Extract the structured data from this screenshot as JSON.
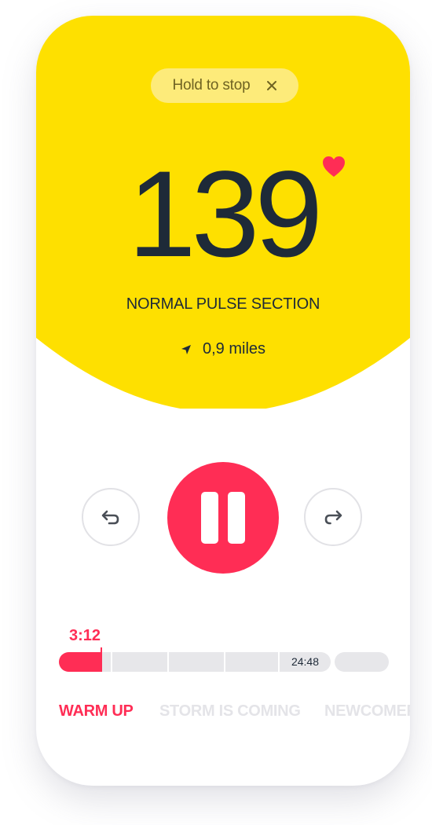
{
  "hero": {
    "background_color": "#fee000",
    "hold_to_stop_label": "Hold to stop",
    "close_icon": "close-icon",
    "pulse_value": "139",
    "heart_icon": "heart-icon",
    "heart_color": "#ff2d55",
    "section_label": "NORMAL PULSE SECTION",
    "distance_icon": "navigation-arrow-icon",
    "distance_text": "0,9 miles"
  },
  "controls": {
    "rewind_icon": "undo-icon",
    "pause_icon": "pause-icon",
    "forward_icon": "redo-icon",
    "accent_color": "#ff2d55"
  },
  "timeline": {
    "elapsed": "3:12",
    "total": "24:48",
    "progress_fraction": 0.129
  },
  "tabs": [
    {
      "label": "WARM UP",
      "active": true
    },
    {
      "label": "STORM IS COMING",
      "active": false
    },
    {
      "label": "NEWCOMER",
      "active": false
    }
  ]
}
